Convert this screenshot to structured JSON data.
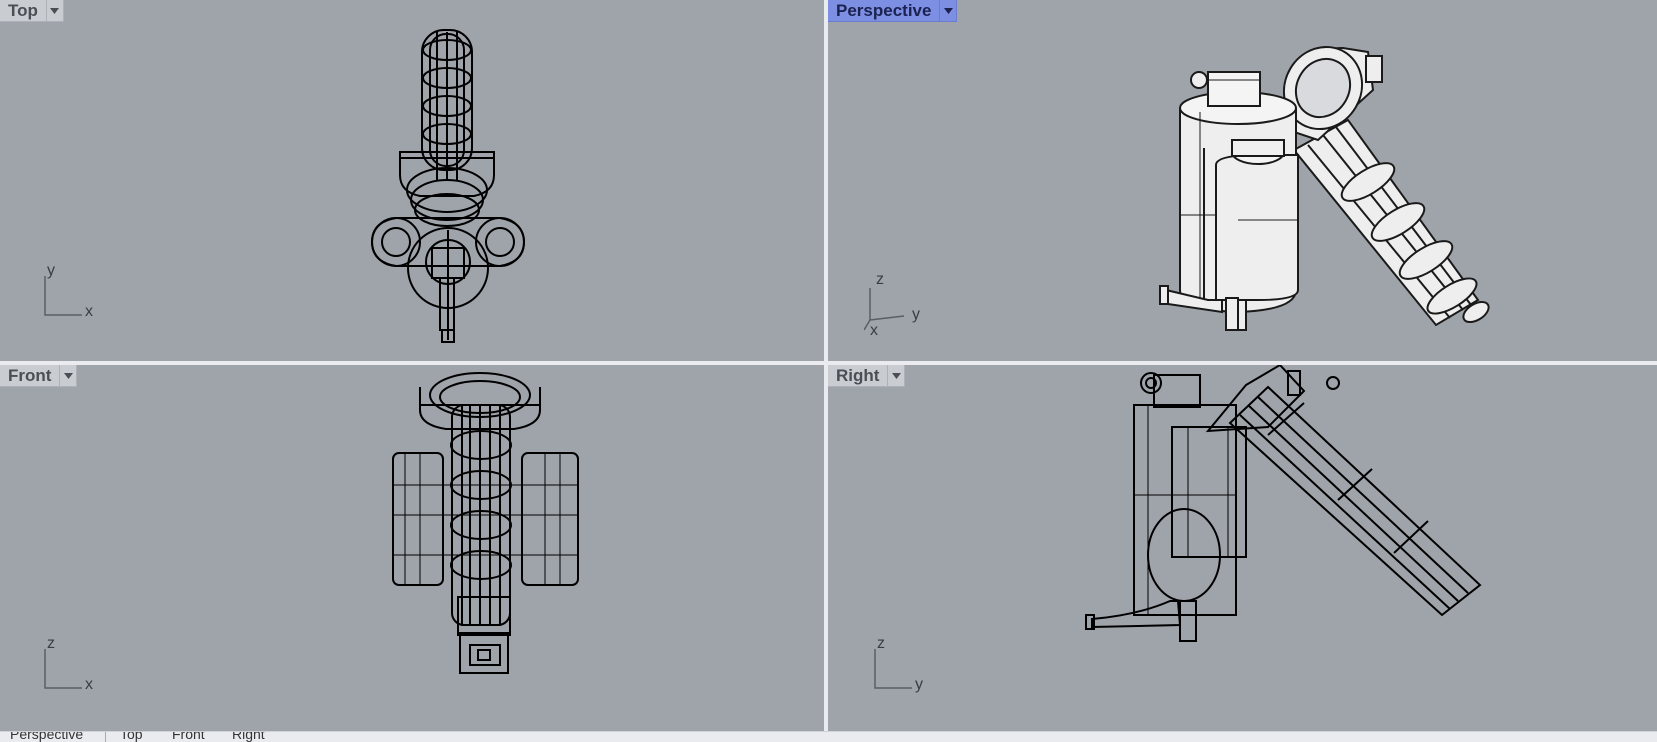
{
  "viewports": {
    "top": {
      "title": "Top",
      "axis_h": "x",
      "axis_v": "y"
    },
    "persp": {
      "title": "Perspective",
      "axis_h": "y",
      "axis_v": "z",
      "axis_d": "x"
    },
    "front": {
      "title": "Front",
      "axis_h": "x",
      "axis_v": "z"
    },
    "right": {
      "title": "Right",
      "axis_h": "y",
      "axis_v": "z"
    }
  },
  "bottom_tabs": [
    "Perspective",
    "Top",
    "Front",
    "Right"
  ],
  "colors": {
    "viewport_bg": "#9fa4ab",
    "active_tab": "#7d8fe3",
    "wire": "#000000",
    "shaded": "#eeeeee"
  }
}
